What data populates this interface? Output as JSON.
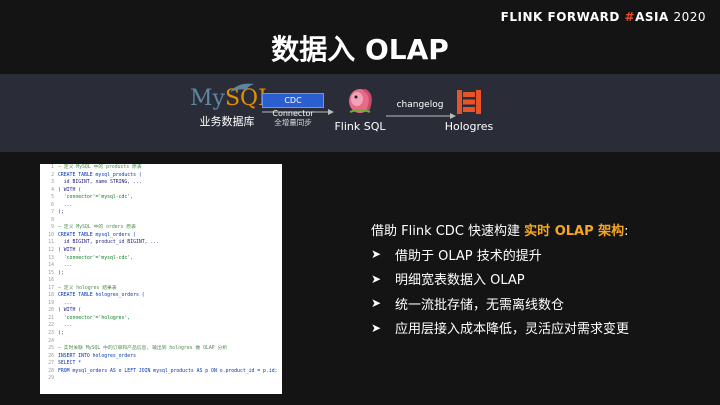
{
  "brand": {
    "part1": "FLINK FORWARD",
    "hash": "#",
    "part2": "ASIA",
    "year": "2020"
  },
  "title": "数据入 OLAP",
  "pipeline": {
    "mysql": {
      "logo_text_a": "My",
      "logo_text_b": "SQL",
      "label": "业务数据库"
    },
    "cdc": {
      "box_label": "CDC Connector",
      "sub_label": "全增量同步"
    },
    "flink": {
      "label": "Flink SQL"
    },
    "changelog_label": "changelog",
    "hologres": {
      "label": "Hologres"
    },
    "accent_blue": "#2b5fd0",
    "hologres_color": "#e8542a"
  },
  "code_lines": [
    {
      "n": "1",
      "t": "— 定义 MySQL 中的 products 原表",
      "c": "comment"
    },
    {
      "n": "2",
      "t": "CREATE TABLE mysql_products (",
      "c": "kw"
    },
    {
      "n": "3",
      "t": "  id BIGINT, name STRING, ...",
      "c": ""
    },
    {
      "n": "4",
      "t": ") WITH (",
      "c": ""
    },
    {
      "n": "5",
      "t": "  'connector'='mysql-cdc',",
      "c": "str"
    },
    {
      "n": "6",
      "t": "  ...",
      "c": ""
    },
    {
      "n": "7",
      "t": ");",
      "c": ""
    },
    {
      "n": "8",
      "t": "",
      "c": ""
    },
    {
      "n": "9",
      "t": "— 定义 MySQL 中的 orders 原表",
      "c": "comment"
    },
    {
      "n": "10",
      "t": "CREATE TABLE mysql_orders (",
      "c": "kw"
    },
    {
      "n": "11",
      "t": "  id BIGINT, product_id BIGINT, ...",
      "c": ""
    },
    {
      "n": "12",
      "t": ") WITH (",
      "c": ""
    },
    {
      "n": "13",
      "t": "  'connector'='mysql-cdc',",
      "c": "str"
    },
    {
      "n": "14",
      "t": "  ...",
      "c": ""
    },
    {
      "n": "15",
      "t": ");",
      "c": ""
    },
    {
      "n": "16",
      "t": "",
      "c": ""
    },
    {
      "n": "17",
      "t": "— 定义 hologres 结果表",
      "c": "comment"
    },
    {
      "n": "18",
      "t": "CREATE TABLE hologres_orders (",
      "c": "kw"
    },
    {
      "n": "19",
      "t": "  ...",
      "c": ""
    },
    {
      "n": "20",
      "t": ") WITH (",
      "c": ""
    },
    {
      "n": "21",
      "t": "  'connector'='hologres',",
      "c": "str"
    },
    {
      "n": "22",
      "t": "  ...",
      "c": ""
    },
    {
      "n": "23",
      "t": ");",
      "c": ""
    },
    {
      "n": "24",
      "t": "",
      "c": ""
    },
    {
      "n": "25",
      "t": "— 实时关联 MySQL 中的订单和产品信息, 输出到 hologres 做 OLAP 分析",
      "c": "comment"
    },
    {
      "n": "26",
      "t": "INSERT INTO hologres_orders",
      "c": "kw"
    },
    {
      "n": "27",
      "t": "SELECT *",
      "c": "kw"
    },
    {
      "n": "28",
      "t": "FROM mysql_orders AS o LEFT JOIN mysql_products AS p ON o.product_id = p.id;",
      "c": "kw"
    },
    {
      "n": "29",
      "t": "",
      "c": ""
    }
  ],
  "headline": {
    "prefix": "借助 Flink CDC 快速构建 ",
    "highlight": "实时 OLAP 架构",
    "suffix": ":"
  },
  "bullet_mark": "➤",
  "bullets": [
    "借助于 OLAP 技术的提升",
    "明细宽表数据入 OLAP",
    "统一流批存储，无需离线数仓",
    "应用层接入成本降低，灵活应对需求变更"
  ]
}
